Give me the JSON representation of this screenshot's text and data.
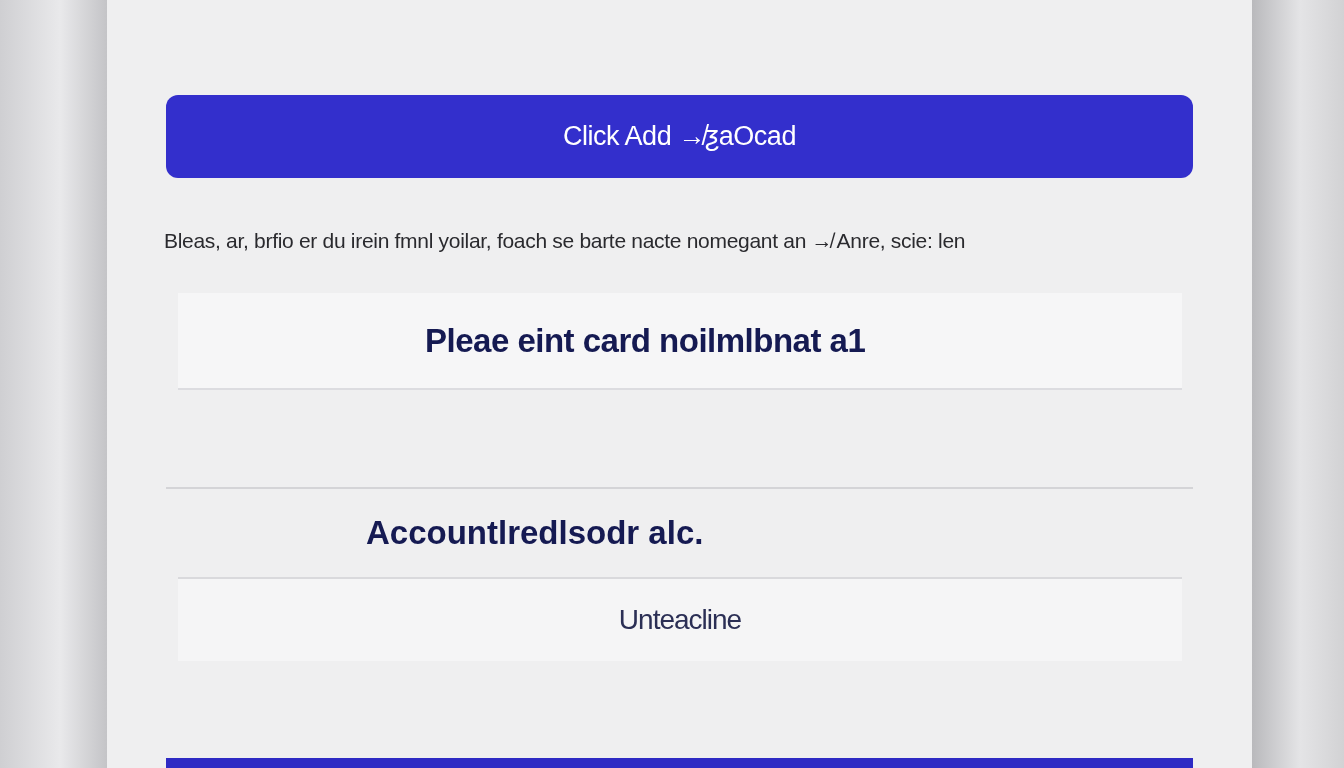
{
  "add_button": {
    "label": "Click Add ↛ƺaOcad"
  },
  "instructions": "Bleas, ar, brfio er du irein fmnl yoilar, foach se barte nacte nomegant an ↛ Anre, scie: len",
  "card_field": {
    "value": "Pleae eint card noilmlbnat a1"
  },
  "account_section": {
    "heading": "Accountlredlsodr alc."
  },
  "account_field": {
    "value": "Unteacline"
  }
}
